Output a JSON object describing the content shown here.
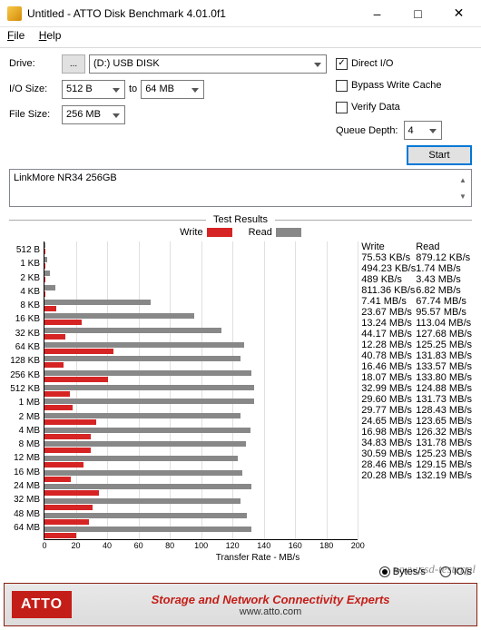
{
  "window": {
    "title": "Untitled - ATTO Disk Benchmark 4.01.0f1"
  },
  "menu": {
    "file": "File",
    "help": "Help"
  },
  "labels": {
    "drive": "Drive:",
    "iosize": "I/O Size:",
    "filesize": "File Size:",
    "to": "to",
    "queue": "Queue Depth:"
  },
  "drive": {
    "button": "...",
    "selected": "(D:) USB DISK"
  },
  "iosize": {
    "from": "512 B",
    "to": "64 MB"
  },
  "filesize": {
    "selected": "256 MB"
  },
  "options": {
    "direct_io": {
      "label": "Direct I/O",
      "checked": true
    },
    "bypass": {
      "label": "Bypass Write Cache",
      "checked": false
    },
    "verify": {
      "label": "Verify Data",
      "checked": false
    }
  },
  "queue_depth": "4",
  "start": "Start",
  "device_text": "LinkMore NR34 256GB",
  "results_title": "Test Results",
  "legend": {
    "write": "Write",
    "read": "Read"
  },
  "xaxis_label": "Transfer Rate - MB/s",
  "radio": {
    "bytes": "Bytes/s",
    "ios": "IO/s"
  },
  "footer": {
    "logo": "ATTO",
    "line1": "Storage and Network Connectivity Experts",
    "line2": "www.atto.com"
  },
  "watermark": "www.ssd-tester.pl",
  "columns": {
    "write": "Write",
    "read": "Read"
  },
  "chart_data": {
    "type": "bar",
    "xlabel": "Transfer Rate - MB/s",
    "xlim": [
      0,
      200
    ],
    "xticks": [
      0,
      20,
      40,
      60,
      80,
      100,
      120,
      140,
      160,
      180,
      200
    ],
    "categories": [
      "512 B",
      "1 KB",
      "2 KB",
      "4 KB",
      "8 KB",
      "16 KB",
      "32 KB",
      "64 KB",
      "128 KB",
      "256 KB",
      "512 KB",
      "1 MB",
      "2 MB",
      "4 MB",
      "8 MB",
      "12 MB",
      "16 MB",
      "24 MB",
      "32 MB",
      "48 MB",
      "64 MB"
    ],
    "series": [
      {
        "name": "Read",
        "unit_label": [
          "879.12 KB/s",
          "1.74 MB/s",
          "3.43 MB/s",
          "6.82 MB/s",
          "67.74 MB/s",
          "95.57 MB/s",
          "113.04 MB/s",
          "127.68 MB/s",
          "125.25 MB/s",
          "131.83 MB/s",
          "133.57 MB/s",
          "133.80 MB/s",
          "124.88 MB/s",
          "131.73 MB/s",
          "128.43 MB/s",
          "123.65 MB/s",
          "126.32 MB/s",
          "131.78 MB/s",
          "125.23 MB/s",
          "129.15 MB/s",
          "132.19 MB/s"
        ],
        "values_mb": [
          0.86,
          1.74,
          3.43,
          6.82,
          67.74,
          95.57,
          113.04,
          127.68,
          125.25,
          131.83,
          133.57,
          133.8,
          124.88,
          131.73,
          128.43,
          123.65,
          126.32,
          131.78,
          125.23,
          129.15,
          132.19
        ]
      },
      {
        "name": "Write",
        "unit_label": [
          "75.53 KB/s",
          "494.23 KB/s",
          "489 KB/s",
          "811.36 KB/s",
          "7.41 MB/s",
          "23.67 MB/s",
          "13.24 MB/s",
          "44.17 MB/s",
          "12.28 MB/s",
          "40.78 MB/s",
          "16.46 MB/s",
          "18.07 MB/s",
          "32.99 MB/s",
          "29.60 MB/s",
          "29.77 MB/s",
          "24.65 MB/s",
          "16.98 MB/s",
          "34.83 MB/s",
          "30.59 MB/s",
          "28.46 MB/s",
          "20.28 MB/s"
        ],
        "values_mb": [
          0.07,
          0.48,
          0.48,
          0.79,
          7.41,
          23.67,
          13.24,
          44.17,
          12.28,
          40.78,
          16.46,
          18.07,
          32.99,
          29.6,
          29.77,
          24.65,
          16.98,
          34.83,
          30.59,
          28.46,
          20.28
        ]
      }
    ]
  }
}
